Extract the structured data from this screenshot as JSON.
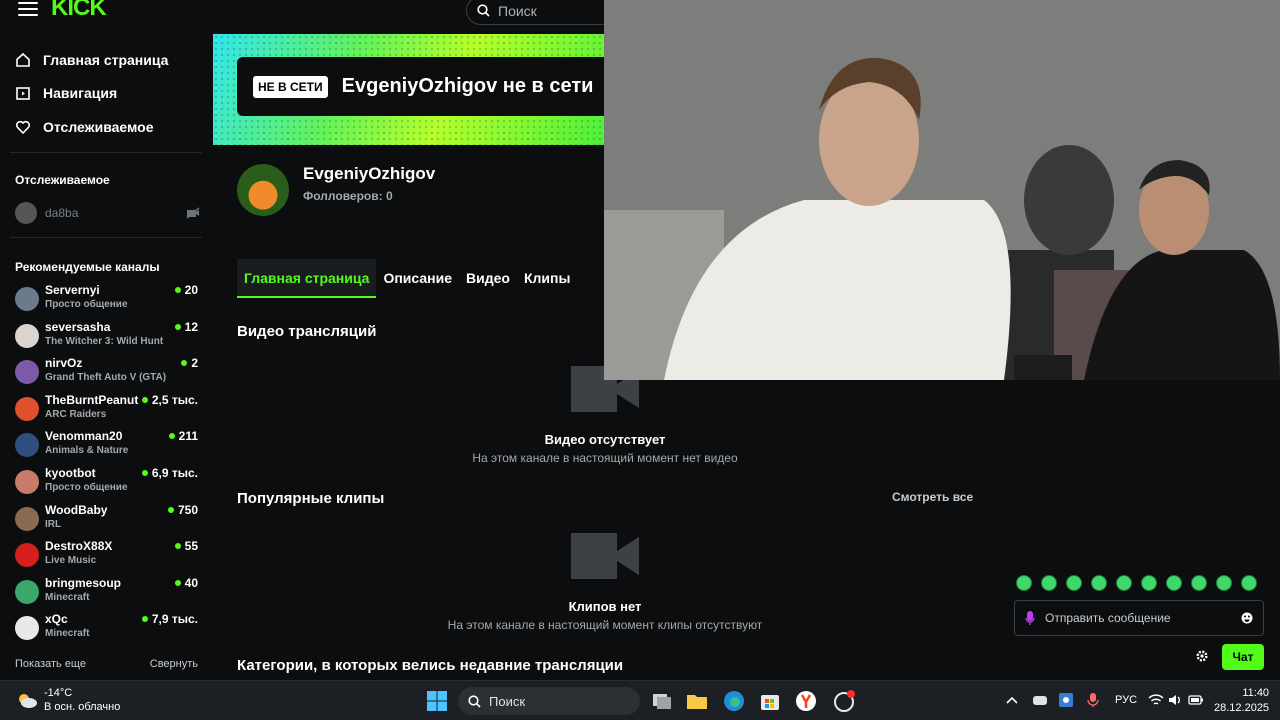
{
  "header": {
    "logo": "KICK",
    "search_placeholder": "Поиск"
  },
  "nav": [
    {
      "label": "Главная страница",
      "icon": "home-icon"
    },
    {
      "label": "Навигация",
      "icon": "browse-icon"
    },
    {
      "label": "Отслеживаемое",
      "icon": "heart-icon"
    }
  ],
  "followed_section": {
    "title": "Отслеживаемое",
    "items": [
      {
        "name": "da8ba",
        "status": "offline"
      }
    ]
  },
  "recommended": {
    "title": "Рекомендуемые каналы",
    "channels": [
      {
        "name": "Servernyi",
        "game": "Просто общение",
        "viewers": "20",
        "color": "#6b7b8c"
      },
      {
        "name": "seversasha",
        "game": "The Witcher 3: Wild Hunt",
        "viewers": "12",
        "color": "#d9d4cf"
      },
      {
        "name": "nirvOz",
        "game": "Grand Theft Auto V (GTA)",
        "viewers": "2",
        "color": "#7c5aa8"
      },
      {
        "name": "TheBurntPeanut",
        "game": "ARC Raiders",
        "viewers": "2,5 тыс.",
        "color": "#e0502a"
      },
      {
        "name": "Venomman20",
        "game": "Animals & Nature",
        "viewers": "211",
        "color": "#2f4f7f"
      },
      {
        "name": "kyootbot",
        "game": "Просто общение",
        "viewers": "6,9 тыс.",
        "color": "#c97b6a"
      },
      {
        "name": "WoodBaby",
        "game": "IRL",
        "viewers": "750",
        "color": "#8a6a52"
      },
      {
        "name": "DestroX88X",
        "game": "Live Music",
        "viewers": "55",
        "color": "#d41f1f"
      },
      {
        "name": "bringmesoup",
        "game": "Minecraft",
        "viewers": "40",
        "color": "#3aa86b"
      },
      {
        "name": "xQc",
        "game": "Minecraft",
        "viewers": "7,9 тыс.",
        "color": "#e8e8e8"
      }
    ],
    "show_more": "Показать еще",
    "collapse": "Свернуть"
  },
  "banner": {
    "badge": "НЕ В СЕТИ",
    "text": "EvgeniyOzhigov не в сети"
  },
  "channel": {
    "name": "EvgeniyOzhigov",
    "followers": "Фолловеров: 0"
  },
  "tabs": [
    "Главная страница",
    "Описание",
    "Видео",
    "Клипы"
  ],
  "videos": {
    "title": "Видео трансляций",
    "empty_title": "Видео отсутствует",
    "empty_sub": "На этом канале в настоящий момент нет видео"
  },
  "clips": {
    "title": "Популярные клипы",
    "see_all": "Смотреть все",
    "empty_title": "Клипов нет",
    "empty_sub": "На этом канале в настоящий момент клипы отсутствуют"
  },
  "categories": {
    "title": "Категории, в которых велись недавние трансляции"
  },
  "chat": {
    "placeholder": "Отправить сообщение",
    "send_label": "Чат"
  },
  "taskbar": {
    "temp": "-14°C",
    "weather": "В осн. облачно",
    "search": "Поиск",
    "lang": "РУС",
    "time": "11:40",
    "date": "28.12.2025"
  }
}
